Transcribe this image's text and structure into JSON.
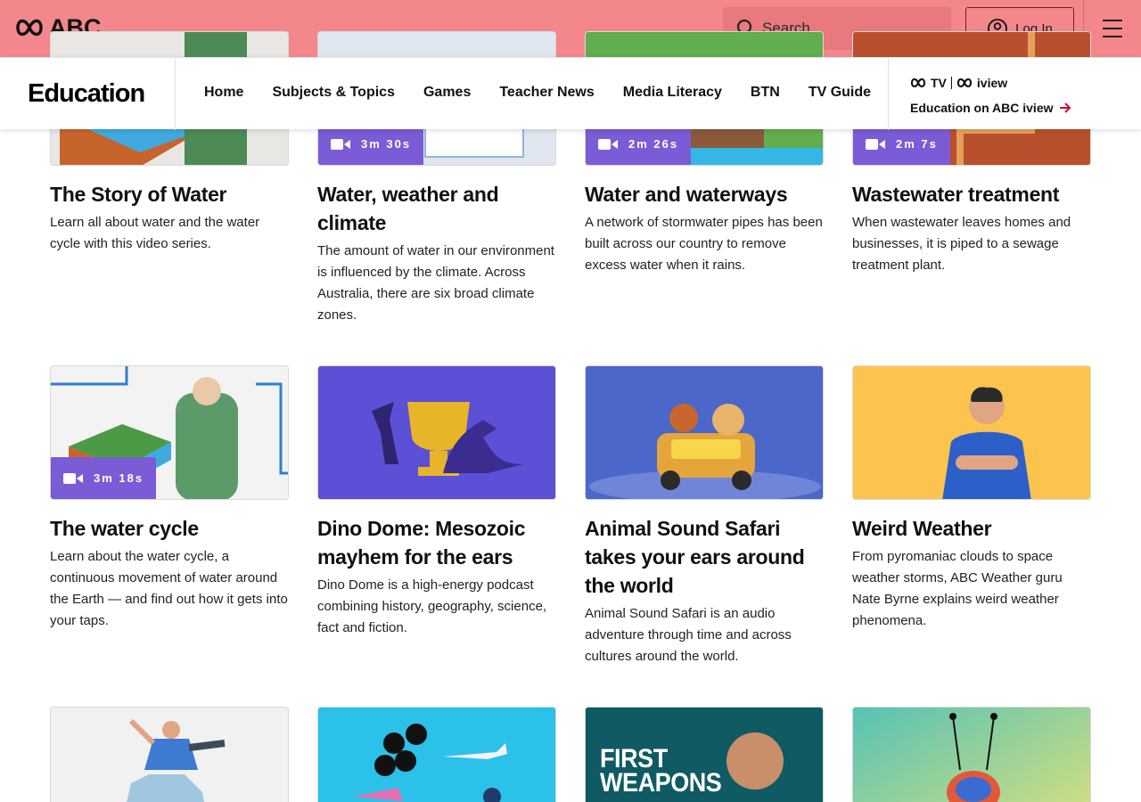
{
  "header": {
    "logo_text": "ABC",
    "search_placeholder": "Search...",
    "login_label": "Log In",
    "brand_color": "#f3878c"
  },
  "nav": {
    "section_title": "Education",
    "links": [
      "Home",
      "Subjects & Topics",
      "Games",
      "Teacher News",
      "Media Literacy",
      "BTN",
      "TV Guide"
    ],
    "iview_logo_tv": "TV",
    "iview_logo_iview": "iview",
    "iview_link": "Education on ABC iview"
  },
  "cards": [
    {
      "title": "The Story of Water",
      "desc": "Learn all about water and the water cycle with this video series.",
      "duration": "",
      "thumb_color": "#e9e7e4"
    },
    {
      "title": "Water, weather and climate",
      "desc": "The amount of water in our environment is influenced by the climate. Across Australia, there are six broad climate zones.",
      "duration": "3m 30s",
      "thumb_color": "#dfe6ef"
    },
    {
      "title": "Water and waterways",
      "desc": "A network of stormwater pipes has been built across our country to remove excess water when it rains.",
      "duration": "2m 26s",
      "thumb_color": "#5aa24a"
    },
    {
      "title": "Wastewater treatment",
      "desc": "When wastewater leaves homes and businesses, it is piped to a sewage treatment plant.",
      "duration": "2m 7s",
      "thumb_color": "#b64b2a"
    },
    {
      "title": "The water cycle",
      "desc": "Learn about the water cycle, a continuous movement of water around the Earth — and find out how it gets into your taps.",
      "duration": "3m 18s",
      "thumb_color": "#f3f3f3"
    },
    {
      "title": "Dino Dome: Mesozoic mayhem for the ears",
      "desc": "Dino Dome is a high-energy podcast combining history, geography, science, fact and fiction.",
      "duration": "",
      "thumb_color": "#5b50d6"
    },
    {
      "title": "Animal Sound Safari takes your ears around the world",
      "desc": "Animal Sound Safari is an audio adventure through time and across cultures around the world.",
      "duration": "",
      "thumb_color": "#4a67c9"
    },
    {
      "title": "Weird Weather",
      "desc": "From pyromaniac clouds to space weather storms, ABC Weather guru Nate Byrne explains weird weather phenomena.",
      "duration": "",
      "thumb_color": "#fcc44e"
    },
    {
      "title": "",
      "desc": "",
      "duration": "",
      "thumb_color": "#f1f1f1"
    },
    {
      "title": "",
      "desc": "",
      "duration": "",
      "thumb_color": "#2bc1e8"
    },
    {
      "title": "",
      "desc": "",
      "duration": "",
      "thumb_color": "#0f5a63",
      "overlay_text_line1": "FIRST",
      "overlay_text_line2": "WEAPONS"
    },
    {
      "title": "",
      "desc": "",
      "duration": "",
      "thumb_color": "#58c2b8"
    }
  ]
}
